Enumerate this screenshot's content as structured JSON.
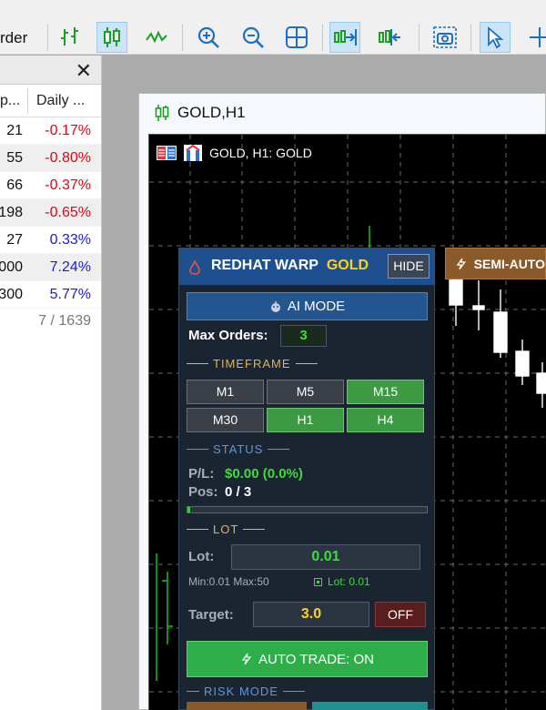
{
  "toolbar": {
    "left_text": "rder",
    "buttons": [
      "bar-chart-icon",
      "candlestick-icon",
      "line-chart-icon",
      "zoom-in-icon",
      "zoom-out-icon",
      "tile-windows-icon",
      "autoscroll-icon",
      "chart-shift-icon",
      "screenshot-icon",
      "cursor-icon",
      "crosshair-icon"
    ]
  },
  "market_watch": {
    "col1": "p...",
    "col2": "Daily ...",
    "rows": [
      {
        "left": "21",
        "change": "-0.17%",
        "dir": "neg"
      },
      {
        "left": "55",
        "change": "-0.80%",
        "dir": "neg"
      },
      {
        "left": "66",
        "change": "-0.37%",
        "dir": "neg"
      },
      {
        "left": "198",
        "change": "-0.65%",
        "dir": "neg"
      },
      {
        "left": "27",
        "change": "0.33%",
        "dir": "pos"
      },
      {
        "left": "000",
        "change": "7.24%",
        "dir": "pos"
      },
      {
        "left": "300",
        "change": "5.77%",
        "dir": "pos"
      }
    ],
    "footer": "7 / 1639"
  },
  "chart_window": {
    "title": "GOLD,H1",
    "chart_label": "GOLD, H1:  GOLD"
  },
  "ea_panel": {
    "title_main": "REDHAT WARP",
    "title_accent": "GOLD",
    "hide_label": "HIDE",
    "ai_mode_label": "AI MODE",
    "max_orders_label": "Max Orders:",
    "max_orders_value": "3",
    "timeframe_label": "TIMEFRAME",
    "timeframes": [
      {
        "label": "M1",
        "active": false
      },
      {
        "label": "M5",
        "active": false
      },
      {
        "label": "M15",
        "active": true
      },
      {
        "label": "M30",
        "active": false
      },
      {
        "label": "H1",
        "active": true
      },
      {
        "label": "H4",
        "active": true
      }
    ],
    "status_label": "STATUS",
    "pl_label": "P/L:",
    "pl_value": "$0.00 (0.0%)",
    "pos_label": "Pos:",
    "pos_value": "0 / 3",
    "progress_fraction": 0.0,
    "lot_section": "LOT",
    "lot_label": "Lot:",
    "lot_value": "0.01",
    "lot_minmax": "Min:0.01 Max:50",
    "lot_current": "Lot: 0.01",
    "target_label": "Target:",
    "target_value": "3.0",
    "off_label": "OFF",
    "auto_trade_label": "AUTO TRADE: ON",
    "risk_mode_label": "RISK MODE"
  },
  "semi_auto_label": "SEMI-AUTO",
  "colors": {
    "accent_blue": "#1e4f8f",
    "gold": "#ffd21f",
    "green": "#3cdc3c",
    "brown": "#8b5a2b"
  }
}
